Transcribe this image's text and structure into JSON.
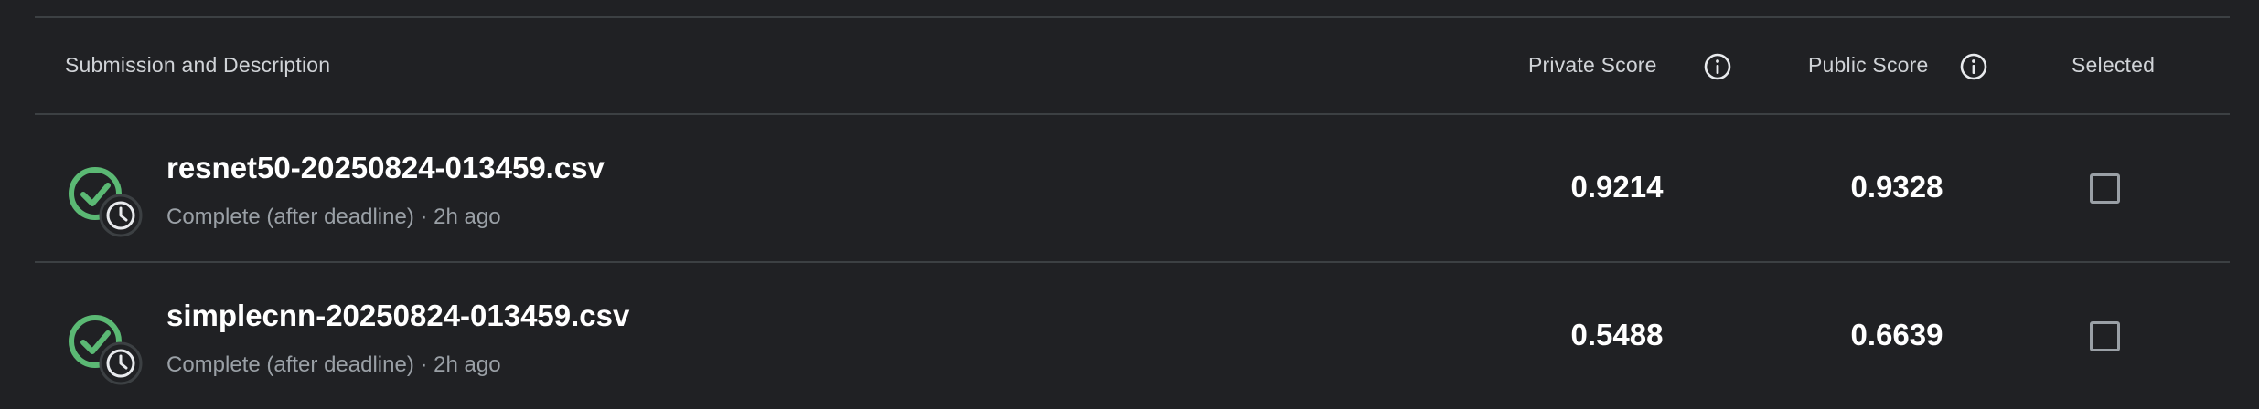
{
  "header": {
    "submission_label": "Submission and Description",
    "private_score_label": "Private Score",
    "public_score_label": "Public Score",
    "selected_label": "Selected"
  },
  "submissions": [
    {
      "name": "resnet50-20250824-013459.csv",
      "description": "Complete (after deadline) · 2h ago",
      "private_score": "0.9214",
      "public_score": "0.9328",
      "selected": false
    },
    {
      "name": "simplecnn-20250824-013459.csv",
      "description": "Complete (after deadline) · 2h ago",
      "private_score": "0.5488",
      "public_score": "0.6639",
      "selected": false
    }
  ],
  "colors": {
    "background": "#202124",
    "success": "#5bb974",
    "divider": "#3c4043"
  },
  "icons": {
    "status": "check-circle-with-clock-icon",
    "info": "info-icon"
  }
}
